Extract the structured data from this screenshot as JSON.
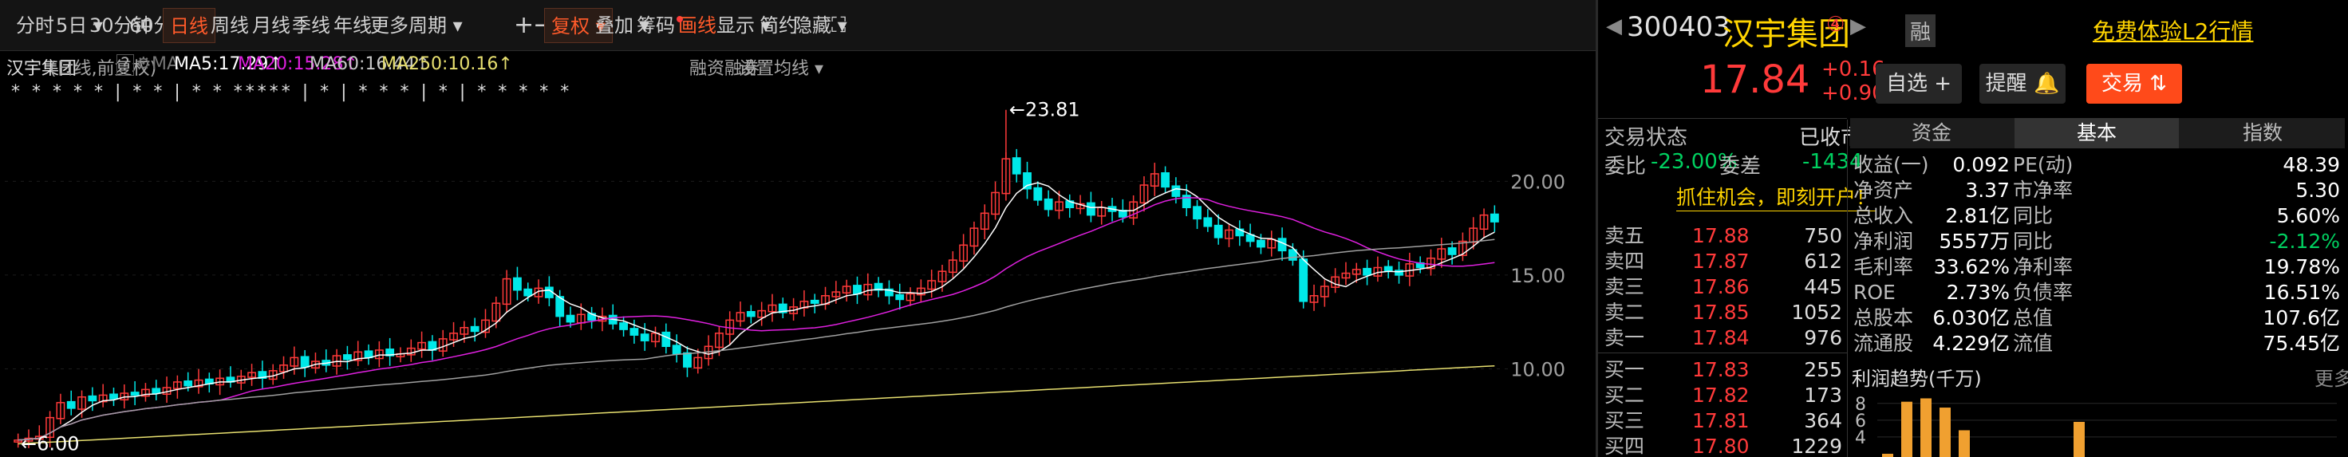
{
  "toolbar": {
    "periods": [
      "分时",
      "5日",
      "30分钟",
      "60分钟",
      "日线",
      "周线",
      "月线",
      "季线",
      "年线",
      "更多周期"
    ],
    "active_period": "日线",
    "buttons": [
      "复权",
      "叠加",
      "筹码",
      "画线",
      "显示",
      "简约",
      "隐藏"
    ],
    "plus": "+",
    "minus": "−",
    "expand_icon": "expand-icon"
  },
  "infobar": {
    "name": "汉宇集团",
    "mode": "(日线,前复权)",
    "help": "?",
    "ma_label": "MA",
    "ma5": "MA5:17.29",
    "ma20": "MA20:15.28",
    "ma60": "MA60:16.44",
    "ma250": "MA250:10.16",
    "arrow": "↑",
    "rzrq": "融资融券",
    "set_ma": "设置均线"
  },
  "chart_data": {
    "type": "candlestick",
    "yticks": [
      10.0,
      15.0,
      20.0
    ],
    "ytick_labels": [
      "10.00",
      "15.00",
      "20.00"
    ],
    "ylim": [
      5.3,
      25.5
    ],
    "high_label": "23.81",
    "low_label": "6.00",
    "high": 23.81,
    "low": 6.0,
    "close": [
      6.2,
      6.3,
      6.4,
      7.4,
      8.2,
      7.9,
      8.5,
      8.3,
      8.6,
      8.4,
      8.7,
      8.6,
      8.9,
      8.7,
      9.0,
      9.3,
      9.1,
      9.4,
      9.2,
      9.5,
      9.3,
      9.6,
      9.8,
      9.5,
      9.9,
      10.2,
      10.6,
      10.1,
      10.4,
      10.2,
      10.7,
      10.5,
      10.9,
      10.6,
      11.0,
      10.7,
      10.8,
      11.1,
      11.4,
      11.0,
      11.6,
      11.9,
      12.2,
      12.0,
      12.6,
      13.5,
      14.8,
      14.2,
      13.9,
      14.3,
      13.8,
      12.8,
      12.5,
      12.9,
      12.6,
      12.8,
      12.4,
      12.1,
      11.8,
      11.5,
      11.9,
      11.2,
      10.8,
      10.1,
      10.6,
      11.2,
      11.9,
      12.6,
      13.0,
      12.8,
      13.1,
      13.4,
      13.0,
      13.3,
      13.6,
      13.5,
      13.9,
      14.1,
      14.4,
      14.0,
      14.5,
      14.2,
      13.9,
      13.7,
      14.0,
      14.3,
      14.7,
      15.2,
      15.8,
      16.6,
      17.5,
      18.3,
      19.4,
      21.2,
      20.4,
      19.6,
      19.0,
      18.5,
      18.9,
      18.6,
      18.8,
      18.2,
      18.6,
      18.4,
      18.1,
      18.9,
      19.8,
      20.4,
      19.7,
      19.2,
      18.6,
      18.0,
      17.6,
      17.0,
      17.4,
      17.1,
      16.8,
      16.5,
      16.9,
      16.3,
      15.8,
      13.6,
      13.9,
      14.4,
      14.9,
      15.1,
      15.3,
      15.0,
      15.4,
      15.2,
      15.0,
      15.6,
      15.4,
      15.9,
      16.4,
      16.1,
      16.8,
      17.5,
      18.2,
      17.84
    ],
    "ma250_range": [
      6.0,
      10.16
    ],
    "markers": "* * * * * | * * | * * ***** | * | * * * | * | * * * * *"
  },
  "quote": {
    "code": "300403",
    "name": "汉宇集团",
    "badge": "④",
    "rong": "融",
    "l2_link": "免费体验L2行情",
    "price": "17.84",
    "change": "+0.16",
    "change_pct": "+0.90%",
    "btn_watch": "自选 +",
    "btn_alert": "提醒",
    "btn_trade": "交易",
    "status_label": "交易状态",
    "status_value": "已收市",
    "wb_label": "委比",
    "wb_value": "-23.00%",
    "wc_label": "委差",
    "wc_value": "-1434",
    "promo": "抓住机会，即刻开户！",
    "asks": [
      {
        "label": "卖五",
        "price": "17.88",
        "vol": "750"
      },
      {
        "label": "卖四",
        "price": "17.87",
        "vol": "612"
      },
      {
        "label": "卖三",
        "price": "17.86",
        "vol": "445"
      },
      {
        "label": "卖二",
        "price": "17.85",
        "vol": "1052"
      },
      {
        "label": "卖一",
        "price": "17.84",
        "vol": "976"
      }
    ],
    "bids": [
      {
        "label": "买一",
        "price": "17.83",
        "vol": "255"
      },
      {
        "label": "买二",
        "price": "17.82",
        "vol": "173"
      },
      {
        "label": "买三",
        "price": "17.81",
        "vol": "364"
      },
      {
        "label": "买四",
        "price": "17.80",
        "vol": "1229"
      }
    ]
  },
  "fundamentals": {
    "tabs": [
      "资金",
      "基本",
      "指数"
    ],
    "active_tab": "基本",
    "rows": [
      {
        "l1": "收益(一)",
        "v1": "0.092",
        "l2": "PE(动)",
        "v2": "48.39"
      },
      {
        "l1": "净资产",
        "v1": "3.37",
        "l2": "市净率",
        "v2": "5.30"
      },
      {
        "l1": "总收入",
        "v1": "2.81亿",
        "l2": "同比",
        "v2": "5.60%"
      },
      {
        "l1": "净利润",
        "v1": "5557万",
        "l2": "同比",
        "v2": "-2.12%"
      },
      {
        "l1": "毛利率",
        "v1": "33.62%",
        "l2": "净利率",
        "v2": "19.78%"
      },
      {
        "l1": "ROE",
        "v1": "2.73%",
        "l2": "负债率",
        "v2": "16.51%"
      },
      {
        "l1": "总股本",
        "v1": "6.030亿",
        "l2": "总值",
        "v2": "107.6亿"
      },
      {
        "l1": "流通股",
        "v1": "4.229亿",
        "l2": "流值",
        "v2": "75.45亿"
      }
    ],
    "profit_title": "利润趋势(千万)",
    "more": "更多",
    "profit_yticks": [
      "8",
      "6",
      "4"
    ],
    "profit_values": [
      2.0,
      8.2,
      8.6,
      7.5,
      4.8,
      0,
      0,
      0,
      0,
      0,
      5.8
    ],
    "colors": {
      "up": "#ff3a3a",
      "down": "#00e8e8",
      "orange": "#ff5a2a",
      "ma5": "#ffffff",
      "ma20": "#e020e0",
      "ma60": "#a0a0a0",
      "ma250": "#e8e070",
      "bar": "#f0a030"
    }
  }
}
